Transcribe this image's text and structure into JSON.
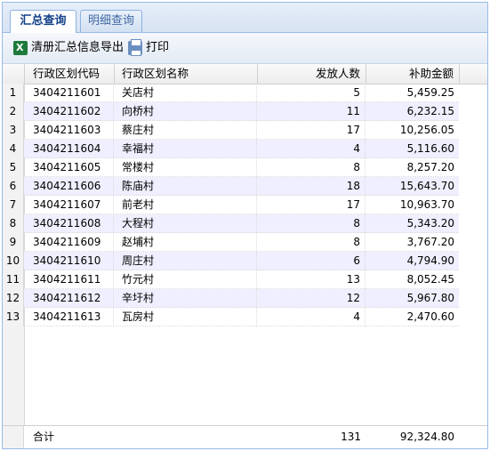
{
  "tabs": [
    {
      "label": "汇总查询",
      "active": true
    },
    {
      "label": "明细查询",
      "active": false
    }
  ],
  "toolbar": {
    "export_label": "清册汇总信息导出",
    "print_label": "打印"
  },
  "columns": {
    "code": "行政区划代码",
    "name": "行政区划名称",
    "count": "发放人数",
    "amount": "补助金额"
  },
  "rows": [
    {
      "n": "1",
      "code": "3404211601",
      "name": "关店村",
      "count": "5",
      "amount": "5,459.25"
    },
    {
      "n": "2",
      "code": "3404211602",
      "name": "向桥村",
      "count": "11",
      "amount": "6,232.15"
    },
    {
      "n": "3",
      "code": "3404211603",
      "name": "蔡庄村",
      "count": "17",
      "amount": "10,256.05"
    },
    {
      "n": "4",
      "code": "3404211604",
      "name": "幸福村",
      "count": "4",
      "amount": "5,116.60"
    },
    {
      "n": "5",
      "code": "3404211605",
      "name": "常楼村",
      "count": "8",
      "amount": "8,257.20"
    },
    {
      "n": "6",
      "code": "3404211606",
      "name": "陈庙村",
      "count": "18",
      "amount": "15,643.70"
    },
    {
      "n": "7",
      "code": "3404211607",
      "name": "前老村",
      "count": "17",
      "amount": "10,963.70"
    },
    {
      "n": "8",
      "code": "3404211608",
      "name": "大程村",
      "count": "8",
      "amount": "5,343.20"
    },
    {
      "n": "9",
      "code": "3404211609",
      "name": "赵埔村",
      "count": "8",
      "amount": "3,767.20"
    },
    {
      "n": "10",
      "code": "3404211610",
      "name": "周庄村",
      "count": "6",
      "amount": "4,794.90"
    },
    {
      "n": "11",
      "code": "3404211611",
      "name": "竹元村",
      "count": "13",
      "amount": "8,052.45"
    },
    {
      "n": "12",
      "code": "3404211612",
      "name": "辛圩村",
      "count": "12",
      "amount": "5,967.80"
    },
    {
      "n": "13",
      "code": "3404211613",
      "name": "瓦房村",
      "count": "4",
      "amount": "2,470.60"
    }
  ],
  "total": {
    "label": "合计",
    "count": "131",
    "amount": "92,324.80"
  },
  "colors": {
    "accent": "#15428b",
    "border": "#99bbe8",
    "alt_row": "#efefff"
  }
}
